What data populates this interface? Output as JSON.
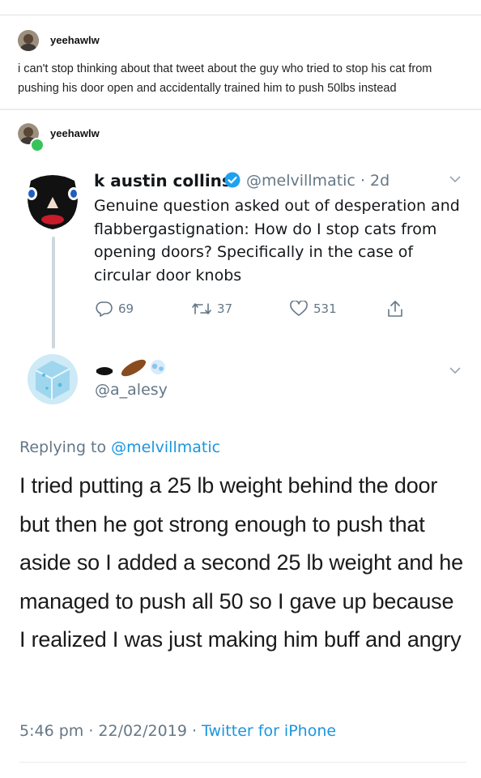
{
  "post1": {
    "username": "yeehawlw",
    "text": "i can't stop thinking about that tweet about the guy who tried to stop his cat from pushing his door open and accidentally trained him to push 50lbs instead"
  },
  "post2": {
    "username": "yeehawlw"
  },
  "tweet1": {
    "display_name": "k austin collins",
    "handle": "@melvillmatic",
    "separator": "·",
    "time": "2d",
    "text": "Genuine question asked out of desperation and flabbergastignation: How do I stop cats from opening doors? Specifically in the case of circular door knobs",
    "replies": "69",
    "retweets": "37",
    "likes": "531"
  },
  "tweet2": {
    "handle": "@a_alesy",
    "replying_label": "Replying to",
    "replying_handle": "@melvillmatic",
    "text": "I tried putting a 25 lb weight behind the door but then he got strong enough to push that aside so I added a second 25 lb weight and he managed to push all 50 so I gave up because I realized I was just making him buff and angry",
    "timestamp": "5:46 pm · 22/02/2019 · ",
    "source": "Twitter for iPhone"
  },
  "colors": {
    "twitter_blue": "#1da1f2",
    "link_blue": "#1b95e0",
    "gray": "#657786"
  },
  "icons": [
    "reply-icon",
    "retweet-icon",
    "like-icon",
    "share-icon",
    "verified-icon",
    "chevron-down-icon"
  ]
}
